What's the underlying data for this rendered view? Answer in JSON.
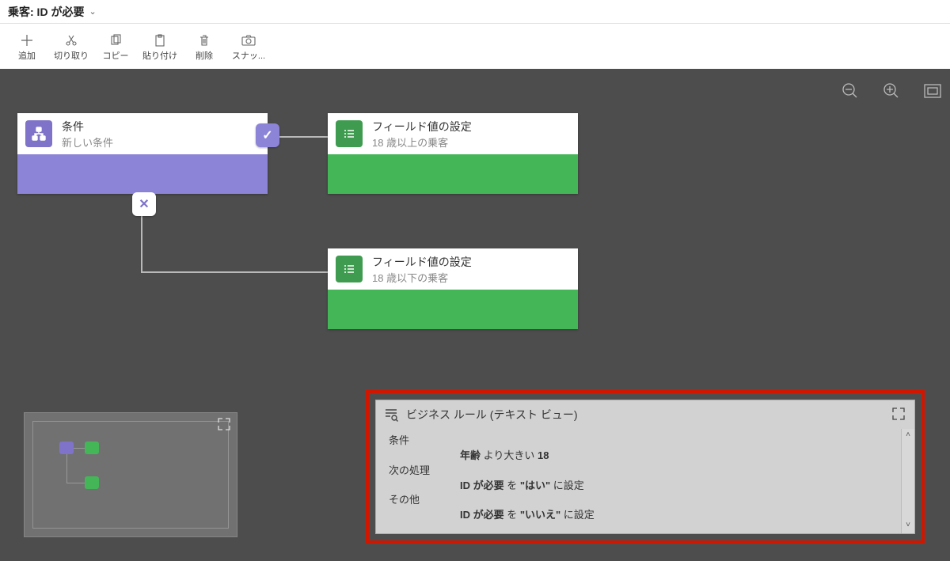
{
  "header": {
    "title": "乗客: ID が必要"
  },
  "toolbar": {
    "add": "追加",
    "cut": "切り取り",
    "copy": "コピー",
    "paste": "貼り付け",
    "delete": "削除",
    "snapshot": "スナッ..."
  },
  "nodes": {
    "condition": {
      "title": "条件",
      "sub": "新しい条件"
    },
    "action_yes": {
      "title": "フィールド値の設定",
      "sub": "18 歳以上の乗客"
    },
    "action_no": {
      "title": "フィールド値の設定",
      "sub": "18 歳以下の乗客"
    }
  },
  "textview": {
    "title": "ビジネス ルール (テキスト ビュー)",
    "rows": {
      "cond_label": "条件",
      "cond_value_pre": "年齢",
      "cond_value_mid": " より大きい ",
      "cond_value_post": "18",
      "then_label": "次の処理",
      "then_value_pre": "ID が必要",
      "then_value_mid_a": " を ",
      "then_value_q1": "\"はい\"",
      "then_value_mid_b": " に設定",
      "else_label": "その他",
      "else_value_pre": "ID が必要",
      "else_value_mid_a": " を ",
      "else_value_q1": "\"いいえ\"",
      "else_value_mid_b": " に設定"
    }
  },
  "glyphs": {
    "check": "✓",
    "cross": "✕",
    "chevron": "⌄",
    "scroll_up": "˄",
    "scroll_down": "˅"
  }
}
